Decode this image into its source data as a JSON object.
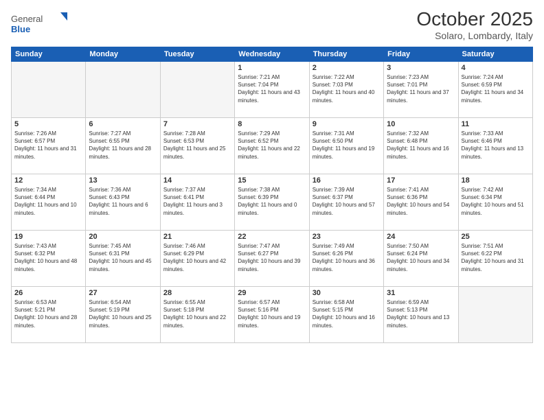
{
  "header": {
    "logo": {
      "general": "General",
      "blue": "Blue"
    },
    "title": "October 2025",
    "location": "Solaro, Lombardy, Italy"
  },
  "calendar": {
    "weekdays": [
      "Sunday",
      "Monday",
      "Tuesday",
      "Wednesday",
      "Thursday",
      "Friday",
      "Saturday"
    ],
    "weeks": [
      [
        {
          "day": "",
          "info": ""
        },
        {
          "day": "",
          "info": ""
        },
        {
          "day": "",
          "info": ""
        },
        {
          "day": "1",
          "info": "Sunrise: 7:21 AM\nSunset: 7:04 PM\nDaylight: 11 hours and 43 minutes."
        },
        {
          "day": "2",
          "info": "Sunrise: 7:22 AM\nSunset: 7:03 PM\nDaylight: 11 hours and 40 minutes."
        },
        {
          "day": "3",
          "info": "Sunrise: 7:23 AM\nSunset: 7:01 PM\nDaylight: 11 hours and 37 minutes."
        },
        {
          "day": "4",
          "info": "Sunrise: 7:24 AM\nSunset: 6:59 PM\nDaylight: 11 hours and 34 minutes."
        }
      ],
      [
        {
          "day": "5",
          "info": "Sunrise: 7:26 AM\nSunset: 6:57 PM\nDaylight: 11 hours and 31 minutes."
        },
        {
          "day": "6",
          "info": "Sunrise: 7:27 AM\nSunset: 6:55 PM\nDaylight: 11 hours and 28 minutes."
        },
        {
          "day": "7",
          "info": "Sunrise: 7:28 AM\nSunset: 6:53 PM\nDaylight: 11 hours and 25 minutes."
        },
        {
          "day": "8",
          "info": "Sunrise: 7:29 AM\nSunset: 6:52 PM\nDaylight: 11 hours and 22 minutes."
        },
        {
          "day": "9",
          "info": "Sunrise: 7:31 AM\nSunset: 6:50 PM\nDaylight: 11 hours and 19 minutes."
        },
        {
          "day": "10",
          "info": "Sunrise: 7:32 AM\nSunset: 6:48 PM\nDaylight: 11 hours and 16 minutes."
        },
        {
          "day": "11",
          "info": "Sunrise: 7:33 AM\nSunset: 6:46 PM\nDaylight: 11 hours and 13 minutes."
        }
      ],
      [
        {
          "day": "12",
          "info": "Sunrise: 7:34 AM\nSunset: 6:44 PM\nDaylight: 11 hours and 10 minutes."
        },
        {
          "day": "13",
          "info": "Sunrise: 7:36 AM\nSunset: 6:43 PM\nDaylight: 11 hours and 6 minutes."
        },
        {
          "day": "14",
          "info": "Sunrise: 7:37 AM\nSunset: 6:41 PM\nDaylight: 11 hours and 3 minutes."
        },
        {
          "day": "15",
          "info": "Sunrise: 7:38 AM\nSunset: 6:39 PM\nDaylight: 11 hours and 0 minutes."
        },
        {
          "day": "16",
          "info": "Sunrise: 7:39 AM\nSunset: 6:37 PM\nDaylight: 10 hours and 57 minutes."
        },
        {
          "day": "17",
          "info": "Sunrise: 7:41 AM\nSunset: 6:36 PM\nDaylight: 10 hours and 54 minutes."
        },
        {
          "day": "18",
          "info": "Sunrise: 7:42 AM\nSunset: 6:34 PM\nDaylight: 10 hours and 51 minutes."
        }
      ],
      [
        {
          "day": "19",
          "info": "Sunrise: 7:43 AM\nSunset: 6:32 PM\nDaylight: 10 hours and 48 minutes."
        },
        {
          "day": "20",
          "info": "Sunrise: 7:45 AM\nSunset: 6:31 PM\nDaylight: 10 hours and 45 minutes."
        },
        {
          "day": "21",
          "info": "Sunrise: 7:46 AM\nSunset: 6:29 PM\nDaylight: 10 hours and 42 minutes."
        },
        {
          "day": "22",
          "info": "Sunrise: 7:47 AM\nSunset: 6:27 PM\nDaylight: 10 hours and 39 minutes."
        },
        {
          "day": "23",
          "info": "Sunrise: 7:49 AM\nSunset: 6:26 PM\nDaylight: 10 hours and 36 minutes."
        },
        {
          "day": "24",
          "info": "Sunrise: 7:50 AM\nSunset: 6:24 PM\nDaylight: 10 hours and 34 minutes."
        },
        {
          "day": "25",
          "info": "Sunrise: 7:51 AM\nSunset: 6:22 PM\nDaylight: 10 hours and 31 minutes."
        }
      ],
      [
        {
          "day": "26",
          "info": "Sunrise: 6:53 AM\nSunset: 5:21 PM\nDaylight: 10 hours and 28 minutes."
        },
        {
          "day": "27",
          "info": "Sunrise: 6:54 AM\nSunset: 5:19 PM\nDaylight: 10 hours and 25 minutes."
        },
        {
          "day": "28",
          "info": "Sunrise: 6:55 AM\nSunset: 5:18 PM\nDaylight: 10 hours and 22 minutes."
        },
        {
          "day": "29",
          "info": "Sunrise: 6:57 AM\nSunset: 5:16 PM\nDaylight: 10 hours and 19 minutes."
        },
        {
          "day": "30",
          "info": "Sunrise: 6:58 AM\nSunset: 5:15 PM\nDaylight: 10 hours and 16 minutes."
        },
        {
          "day": "31",
          "info": "Sunrise: 6:59 AM\nSunset: 5:13 PM\nDaylight: 10 hours and 13 minutes."
        },
        {
          "day": "",
          "info": ""
        }
      ]
    ]
  }
}
